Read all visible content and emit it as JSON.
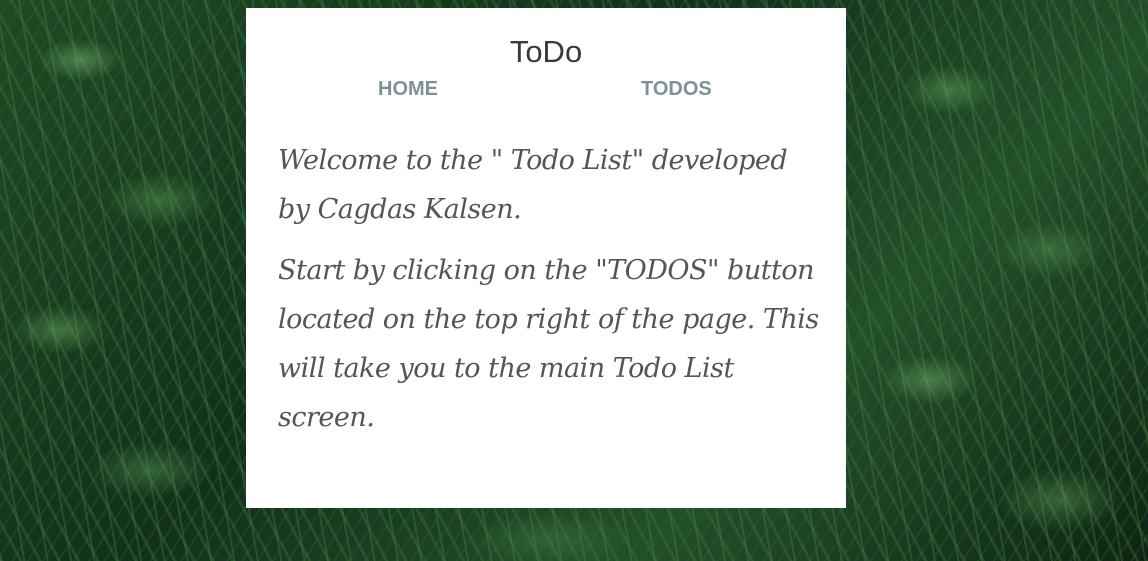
{
  "header": {
    "title": "ToDo"
  },
  "nav": {
    "home_label": "HOME",
    "todos_label": "TODOS"
  },
  "content": {
    "welcome_text": "Welcome to the \" Todo List\" developed by Cagdas Kalsen.",
    "instruction_text": "Start by clicking on the \"TODOS\" button located on the top right of the page. This will take you to the main Todo List screen."
  },
  "colors": {
    "card_background": "#ffffff",
    "nav_link": "#7e9296",
    "title_text": "#3a3a3a",
    "body_text": "#555555",
    "background": "#1f4a25"
  }
}
